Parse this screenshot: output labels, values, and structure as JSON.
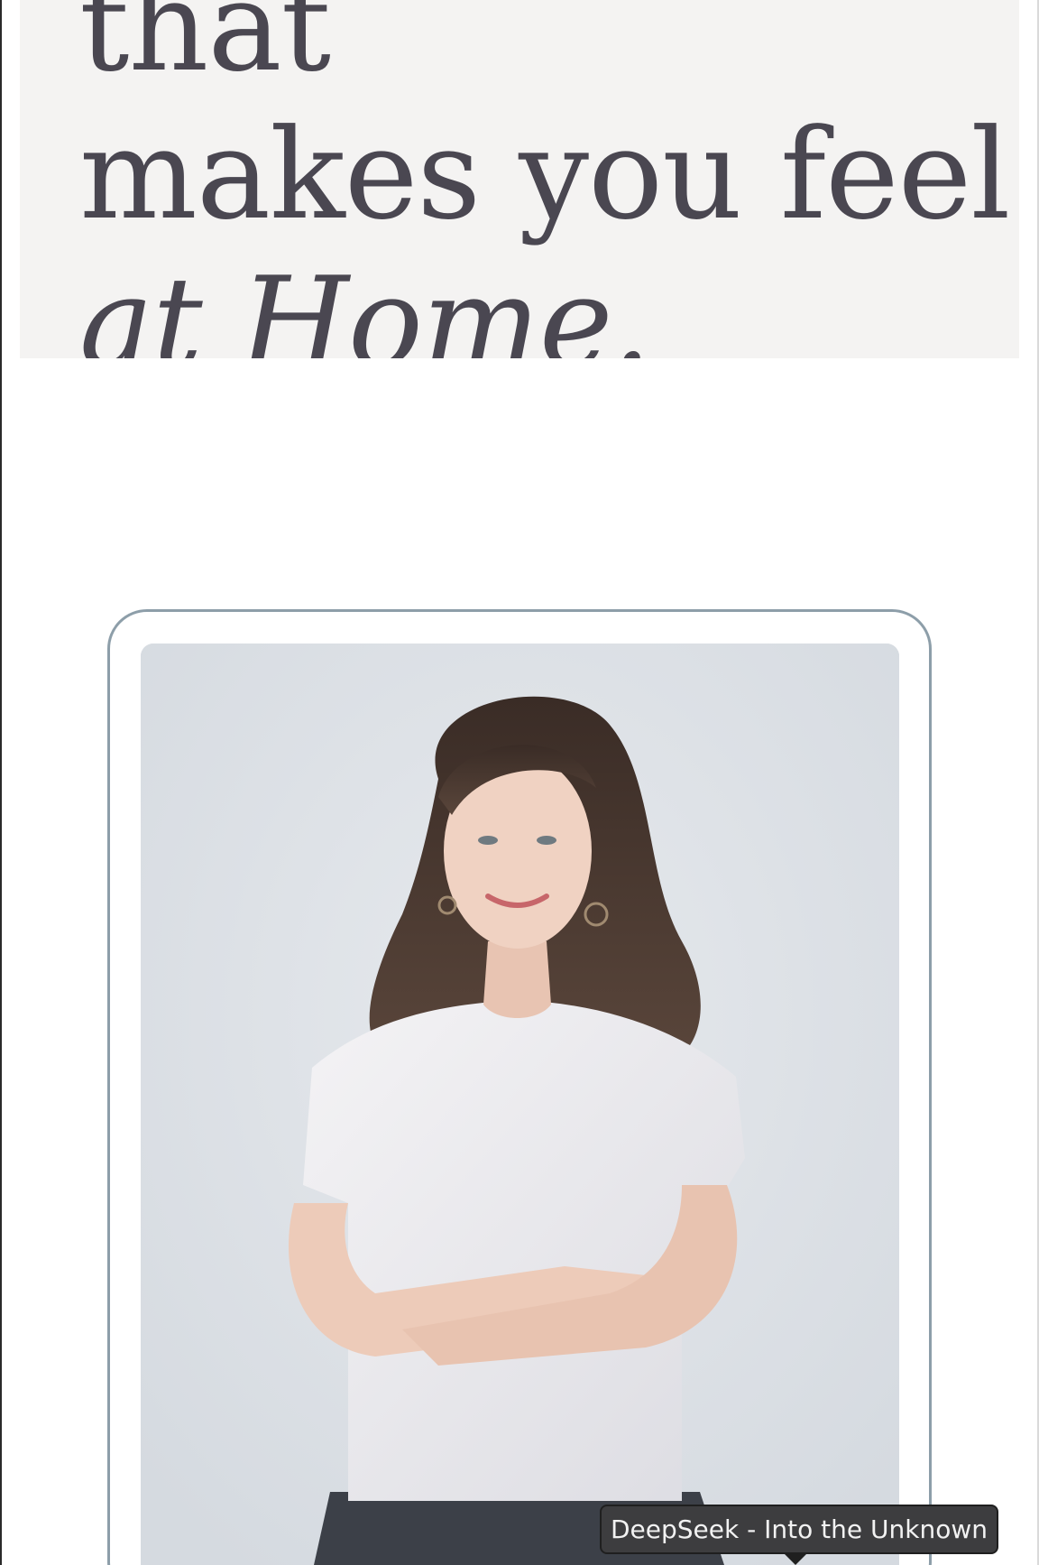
{
  "hero": {
    "partial_top_line": "that",
    "line_1": "makes you feel",
    "line_2_italic": "at Home.",
    "background": "#f4f3f2",
    "text_color": "#4a4751"
  },
  "photo_card": {
    "border_color": "#8d9ea9",
    "image_subject": "portrait-photo"
  },
  "tooltip": {
    "text": "DeepSeek - Into the Unknown"
  }
}
